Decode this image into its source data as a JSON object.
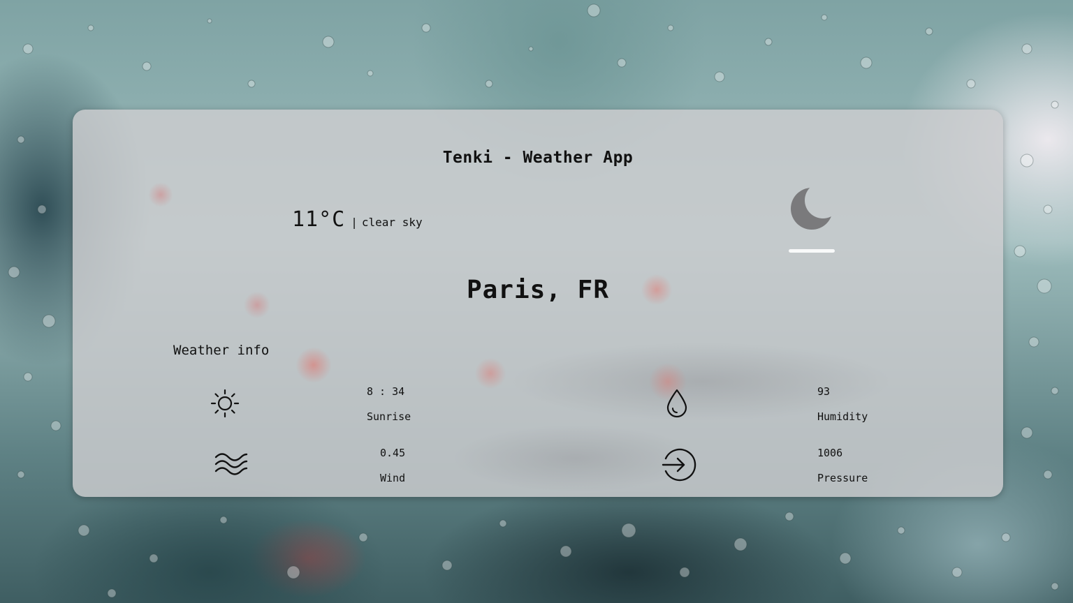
{
  "app": {
    "title": "Tenki - Weather App"
  },
  "current": {
    "temperature": "11°C",
    "separator": "|",
    "description": "clear sky",
    "condition_icon": "moon-icon",
    "location": "Paris, FR"
  },
  "weather_info": {
    "heading": "Weather info",
    "items": [
      {
        "icon": "sun-icon",
        "value": "8 : 34",
        "label": "Sunrise"
      },
      {
        "icon": "water-drop-icon",
        "value": "93",
        "label": "Humidity"
      },
      {
        "icon": "wind-waves-icon",
        "value": "0.45",
        "label": "Wind"
      },
      {
        "icon": "arrow-circle-right-icon",
        "value": "1006",
        "label": "Pressure"
      }
    ]
  },
  "colors": {
    "card_background": "#cdcdd0",
    "text": "#111111",
    "moon": "#7a7a7c"
  }
}
